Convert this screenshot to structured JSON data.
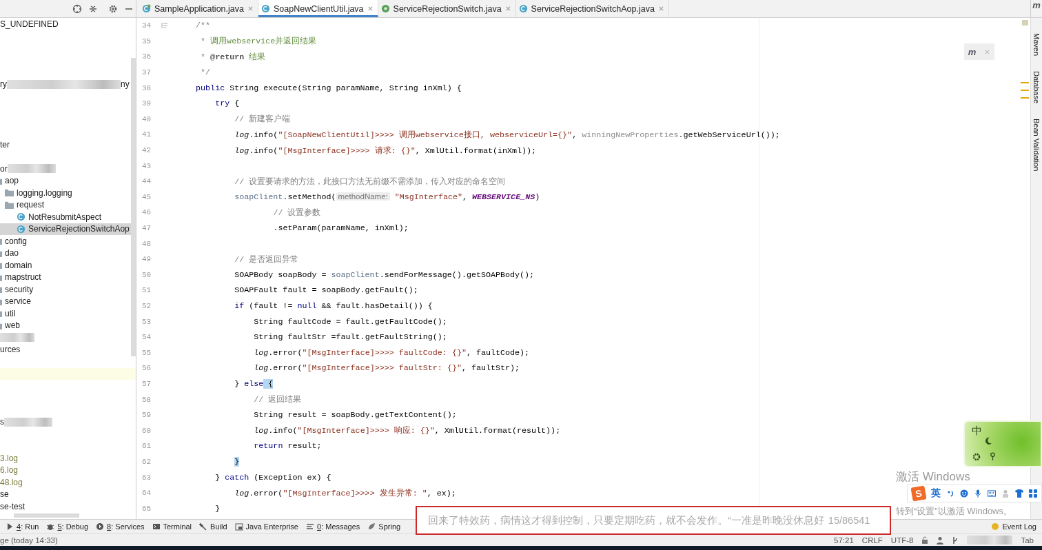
{
  "tabs": [
    {
      "label": "SampleApplication.java",
      "kind": "spring-class",
      "selected": false
    },
    {
      "label": "SoapNewClientUtil.java",
      "kind": "class",
      "selected": true
    },
    {
      "label": "ServiceRejectionSwitch.java",
      "kind": "enum",
      "selected": false
    },
    {
      "label": "ServiceRejectionSwitchAop.java",
      "kind": "class",
      "selected": false
    }
  ],
  "tree": [
    {
      "kind": "fragment",
      "label": "S_UNDEFINED",
      "selected": false
    },
    {
      "kind": "blank",
      "selected": false
    },
    {
      "kind": "blank",
      "selected": false
    },
    {
      "kind": "blank",
      "selected": false
    },
    {
      "kind": "blank",
      "selected": false
    },
    {
      "kind": "blurred",
      "label": "ry",
      "tail": "ny",
      "selected": false
    },
    {
      "kind": "blank",
      "selected": false
    },
    {
      "kind": "blank",
      "selected": false
    },
    {
      "kind": "blank",
      "selected": false
    },
    {
      "kind": "blank",
      "selected": false
    },
    {
      "kind": "fragment",
      "label": "ter",
      "selected": false
    },
    {
      "kind": "blank",
      "selected": false
    },
    {
      "kind": "blurred",
      "label": "or",
      "selected": false
    },
    {
      "kind": "folder",
      "label": "aop",
      "selected": false,
      "children": [
        {
          "kind": "folder",
          "label": "logging.logging",
          "selected": false
        },
        {
          "kind": "folder",
          "label": "request",
          "selected": false,
          "children": [
            {
              "kind": "class",
              "label": "NotResubmitAspect",
              "selected": false
            },
            {
              "kind": "class",
              "label": "ServiceRejectionSwitchAop",
              "selected": true
            }
          ]
        }
      ]
    },
    {
      "kind": "folder",
      "label": "config",
      "selected": false
    },
    {
      "kind": "folder",
      "label": "dao",
      "selected": false
    },
    {
      "kind": "folder",
      "label": "domain",
      "selected": false
    },
    {
      "kind": "folder",
      "label": "mapstruct",
      "selected": false
    },
    {
      "kind": "folder",
      "label": "security",
      "selected": false
    },
    {
      "kind": "folder",
      "label": "service",
      "selected": false
    },
    {
      "kind": "folder",
      "label": "util",
      "selected": false
    },
    {
      "kind": "folder",
      "label": "web",
      "selected": false
    },
    {
      "kind": "blurred",
      "selected": false
    },
    {
      "kind": "fragment",
      "label": "urces",
      "selected": false
    },
    {
      "kind": "blank",
      "selected": false
    },
    {
      "kind": "caret-row",
      "selected": false
    },
    {
      "kind": "blank",
      "selected": false
    },
    {
      "kind": "blank",
      "selected": false
    },
    {
      "kind": "blank",
      "selected": false
    },
    {
      "kind": "blurred",
      "label": "s",
      "selected": false
    },
    {
      "kind": "blank",
      "selected": false
    },
    {
      "kind": "blank",
      "selected": false
    },
    {
      "kind": "log",
      "label": "3.log",
      "selected": false
    },
    {
      "kind": "log",
      "label": "6.log",
      "selected": false
    },
    {
      "kind": "log",
      "label": "48.log",
      "selected": false
    },
    {
      "kind": "fragment",
      "label": "se",
      "selected": false
    },
    {
      "kind": "fragment",
      "label": "se-test",
      "selected": false
    }
  ],
  "right_stripe_icon": "m",
  "notification": {
    "icon": "m"
  },
  "editor": {
    "lines": [
      {
        "n": "34",
        "kind": "javadoc-start",
        "t": [
          {
            "kind": "doc",
            "text": "    /**"
          }
        ]
      },
      {
        "n": "35",
        "kind": "code",
        "t": [
          {
            "kind": "doc",
            "text": "     *"
          },
          {
            "kind": "doctext",
            "text": " 调用webservice并返回结果"
          }
        ]
      },
      {
        "n": "36",
        "kind": "code",
        "t": [
          {
            "kind": "doc",
            "text": "     *"
          },
          {
            "kind": "doctag",
            "text": " @return"
          },
          {
            "kind": "doctext",
            "text": " 结果"
          }
        ]
      },
      {
        "n": "37",
        "kind": "code",
        "t": [
          {
            "kind": "doc",
            "text": "     */"
          }
        ]
      },
      {
        "n": "38",
        "kind": "code",
        "t": [
          {
            "kind": "kw",
            "text": "    public"
          },
          {
            "kind": "plain",
            "text": " String execute(String paramName, String inXml) {"
          }
        ]
      },
      {
        "n": "39",
        "kind": "code",
        "t": [
          {
            "kind": "kw",
            "text": "        try"
          },
          {
            "kind": "plain",
            "text": " {"
          }
        ]
      },
      {
        "n": "40",
        "kind": "code",
        "t": [
          {
            "kind": "comment",
            "text": "            // 新建客户端"
          }
        ]
      },
      {
        "n": "41",
        "kind": "code",
        "t": [
          {
            "kind": "static",
            "text": "            log"
          },
          {
            "kind": "plain",
            "text": ".info("
          },
          {
            "kind": "str",
            "text": "\"[SoapNewClientUtil]>>>> 调用webservice接口, webserviceUrl={}\""
          },
          {
            "kind": "plain",
            "text": ","
          },
          {
            "kind": "muted",
            "text": " winningNewProperties"
          },
          {
            "kind": "plain",
            "text": ".getWebServiceUrl());"
          }
        ]
      },
      {
        "n": "42",
        "kind": "code",
        "t": [
          {
            "kind": "static",
            "text": "            log"
          },
          {
            "kind": "plain",
            "text": ".info("
          },
          {
            "kind": "str",
            "text": "\"[MsgInterface]>>>> 请求: {}\""
          },
          {
            "kind": "plain",
            "text": ", XmlUtil.format(inXml));"
          }
        ]
      },
      {
        "n": "43",
        "kind": "code"
      },
      {
        "n": "44",
        "kind": "code",
        "t": [
          {
            "kind": "comment",
            "text": "            // 设置要请求的方法，此接口方法无前缀不需添加，传入对应的命名空间"
          }
        ]
      },
      {
        "n": "45",
        "kind": "code",
        "t": [
          {
            "kind": "field",
            "text": "            soapClient"
          },
          {
            "kind": "plain",
            "text": ".setMethod("
          },
          {
            "kind": "hint",
            "text": "methodName:"
          },
          {
            "kind": "str",
            "text": " \"MsgInterface\""
          },
          {
            "kind": "plain",
            "text": ","
          },
          {
            "kind": "const",
            "text": " WEBSERVICE_NS"
          },
          {
            "kind": "plain",
            "text": ")"
          }
        ]
      },
      {
        "n": "46",
        "kind": "code",
        "t": [
          {
            "kind": "comment",
            "text": "                    // 设置参数"
          }
        ]
      },
      {
        "n": "47",
        "kind": "code",
        "t": [
          {
            "kind": "plain",
            "text": "                    .setParam(paramName, inXml);"
          }
        ]
      },
      {
        "n": "48",
        "kind": "code"
      },
      {
        "n": "49",
        "kind": "code",
        "t": [
          {
            "kind": "comment",
            "text": "            // 是否返回异常"
          }
        ]
      },
      {
        "n": "50",
        "kind": "code",
        "t": [
          {
            "kind": "plain",
            "text": "            SOAPBody soapBody ="
          },
          {
            "kind": "field",
            "text": " soapClient"
          },
          {
            "kind": "plain",
            "text": ".sendForMessage().getSOAPBody();"
          }
        ]
      },
      {
        "n": "51",
        "kind": "code",
        "t": [
          {
            "kind": "plain",
            "text": "            SOAPFault fault = soapBody.getFault();"
          }
        ]
      },
      {
        "n": "52",
        "kind": "code",
        "t": [
          {
            "kind": "kw",
            "text": "            if"
          },
          {
            "kind": "plain",
            "text": " (fault !="
          },
          {
            "kind": "kw",
            "text": " null"
          },
          {
            "kind": "plain",
            "text": " && fault.hasDetail()) {"
          }
        ]
      },
      {
        "n": "53",
        "kind": "code",
        "t": [
          {
            "kind": "plain",
            "text": "                String faultCode = fault.getFaultCode();"
          }
        ]
      },
      {
        "n": "54",
        "kind": "code",
        "t": [
          {
            "kind": "plain",
            "text": "                String faultStr =fault.getFaultString();"
          }
        ]
      },
      {
        "n": "55",
        "kind": "code",
        "t": [
          {
            "kind": "static",
            "text": "                log"
          },
          {
            "kind": "plain",
            "text": ".error("
          },
          {
            "kind": "str",
            "text": "\"[MsgInterface]>>>> faultCode: {}\""
          },
          {
            "kind": "plain",
            "text": ", faultCode);"
          }
        ]
      },
      {
        "n": "56",
        "kind": "code",
        "t": [
          {
            "kind": "static",
            "text": "                log"
          },
          {
            "kind": "plain",
            "text": ".error("
          },
          {
            "kind": "str",
            "text": "\"[MsgInterface]>>>> faultStr: {}\""
          },
          {
            "kind": "plain",
            "text": ", faultStr);"
          }
        ]
      },
      {
        "n": "57",
        "kind": "code",
        "t": [
          {
            "kind": "plain",
            "text": "            }"
          },
          {
            "kind": "kw",
            "text": " else"
          },
          {
            "kind": "match",
            "text": " {"
          }
        ]
      },
      {
        "n": "58",
        "kind": "code",
        "t": [
          {
            "kind": "comment",
            "text": "                // 返回结果"
          }
        ]
      },
      {
        "n": "59",
        "kind": "code",
        "t": [
          {
            "kind": "plain",
            "text": "                String result = soapBody.getTextContent();"
          }
        ]
      },
      {
        "n": "60",
        "kind": "code",
        "t": [
          {
            "kind": "static",
            "text": "                log"
          },
          {
            "kind": "plain",
            "text": ".info("
          },
          {
            "kind": "str",
            "text": "\"[MsgInterface]>>>> 响应: {}\""
          },
          {
            "kind": "plain",
            "text": ", XmlUtil.format(result));"
          }
        ]
      },
      {
        "n": "61",
        "kind": "code",
        "t": [
          {
            "kind": "kw",
            "text": "                return"
          },
          {
            "kind": "plain",
            "text": " result;"
          }
        ]
      },
      {
        "n": "62",
        "kind": "code",
        "t": [
          {
            "kind": "match",
            "text": "            }"
          }
        ]
      },
      {
        "n": "63",
        "kind": "code",
        "t": [
          {
            "kind": "plain",
            "text": "        }"
          },
          {
            "kind": "kw",
            "text": " catch"
          },
          {
            "kind": "plain",
            "text": " (Exception ex) {"
          }
        ]
      },
      {
        "n": "64",
        "kind": "code",
        "t": [
          {
            "kind": "static",
            "text": "            log"
          },
          {
            "kind": "plain",
            "text": ".error("
          },
          {
            "kind": "str",
            "text": "\"[MsgInterface]>>>> 发生异常: \""
          },
          {
            "kind": "plain",
            "text": ", ex);"
          }
        ]
      },
      {
        "n": "65",
        "kind": "code",
        "t": [
          {
            "kind": "plain",
            "text": "        }"
          }
        ]
      }
    ]
  },
  "right_tools": [
    "Maven",
    "Database",
    "Bean Validation"
  ],
  "tool_windows": [
    {
      "kind": "run",
      "key": "4",
      "label": ": Run"
    },
    {
      "kind": "debug",
      "key": "5",
      "label": ": Debug"
    },
    {
      "kind": "services",
      "key": "8",
      "label": ": Services"
    },
    {
      "kind": "terminal",
      "label": "Terminal"
    },
    {
      "kind": "build",
      "label": "Build"
    },
    {
      "kind": "java-enterprise",
      "label": "Java Enterprise"
    },
    {
      "kind": "messages",
      "key": "0",
      "label": ": Messages"
    },
    {
      "kind": "spring",
      "label": "Spring"
    }
  ],
  "event_log": "Event Log",
  "status_bar": {
    "message": "ge (today 14:33)",
    "position": "57:21",
    "line_separator": "CRLF",
    "encoding": "UTF-8",
    "indent": "Tab"
  },
  "ime": {
    "logo": "S",
    "composition": "回来了特效药，病情这才得到控制，只要定期吃药，就不会发作。“一准是昨晚没休息好",
    "count": "15/86541",
    "mode": "英",
    "skin_mode": "中"
  },
  "windows_activation": {
    "title": "激活 Windows",
    "hint": "转到“设置”以激活 Windows。"
  }
}
